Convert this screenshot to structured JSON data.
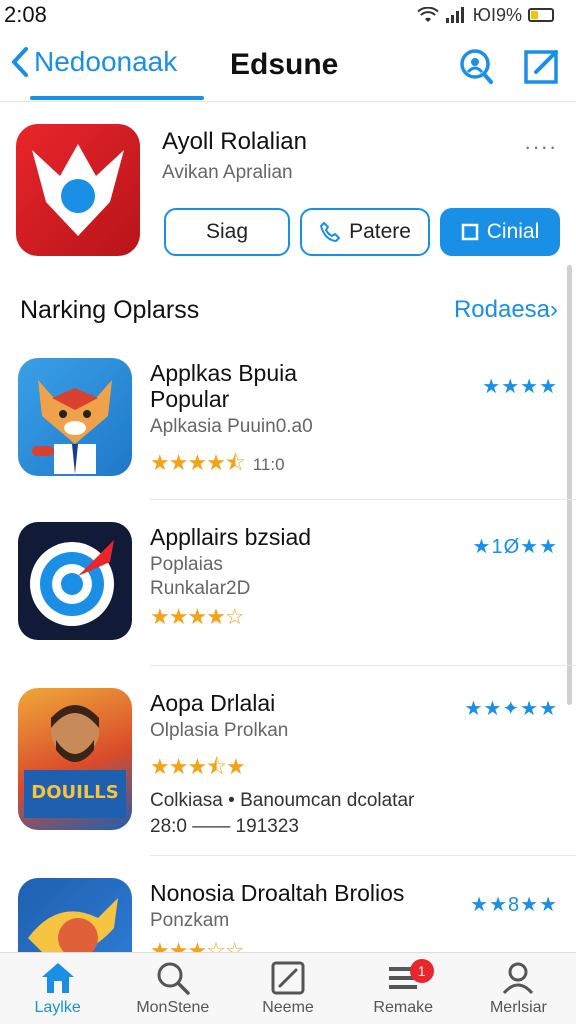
{
  "status_bar": {
    "time": "2:08",
    "battery_text": "ЮI9%",
    "battery_level": 0.35
  },
  "nav": {
    "back_label": "Nedoonaak",
    "title": "Edsune",
    "icons": [
      "search-icon",
      "compose-icon"
    ]
  },
  "featured": {
    "name": "Ayoll Rolalian",
    "subtitle": "Avikan Apralian",
    "more": "····",
    "buttons": {
      "first": "Siag",
      "second": "Patere",
      "third": "Cinial"
    }
  },
  "section": {
    "title": "Narking Oplarss",
    "link": "Rodaesa›"
  },
  "apps": [
    {
      "name": "Applkas Bpuia",
      "name2": "Popular",
      "sub": "Aplkasia Puuin0.a0",
      "stars": "★★★★⯪",
      "count": "11:0",
      "blue_stars": "★★★★"
    },
    {
      "name": "Appllairs bzsiad",
      "sub": "Poplaias",
      "sub2": "Runkalar2D",
      "stars": "★★★★☆",
      "count": "",
      "blue_stars": "★1Ø★★"
    },
    {
      "name": "Aopa Drlalai",
      "sub": "Olplasia Prolkan",
      "stars": "★★★⯪★",
      "count": "",
      "blue_stars": "★★✦★★",
      "meta": "Colkiasa • Banoumcan dcolatar",
      "meta2": "28:0 —— 191323"
    },
    {
      "name": "Nonosia Droaltah Brolios",
      "sub": "Ponzkam",
      "stars": "★★★☆☆",
      "count": "",
      "blue_stars": "★★8★★"
    }
  ],
  "tabs": [
    {
      "label": "Laylke",
      "icon": "home-icon",
      "active": true
    },
    {
      "label": "MonStene",
      "icon": "search-icon",
      "active": false
    },
    {
      "label": "Neeme",
      "icon": "edit-icon",
      "active": false
    },
    {
      "label": "Remake",
      "icon": "list-icon",
      "active": false,
      "badge": "1"
    },
    {
      "label": "Merlsiar",
      "icon": "profile-icon",
      "active": false
    }
  ],
  "colors": {
    "accent": "#1a8fe6",
    "star_orange": "#f4a315",
    "badge_red": "#e8262b"
  }
}
